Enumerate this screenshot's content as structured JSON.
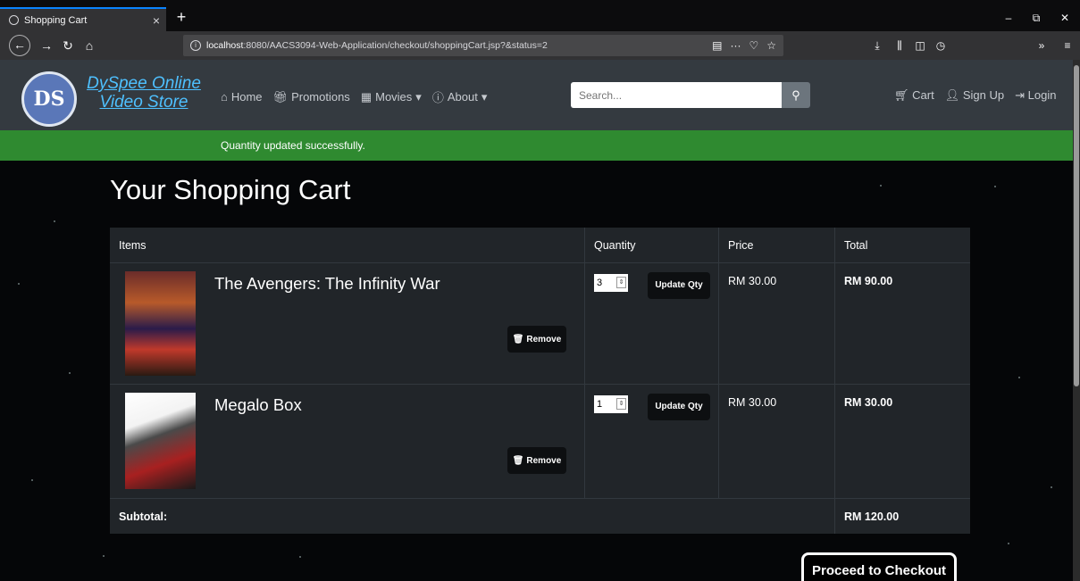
{
  "browser": {
    "tab_title": "Shopping Cart",
    "tab_close": "×",
    "new_tab": "+",
    "url_host": "localhost",
    "url_rest": ":8080/AACS3094-Web-Application/checkout/shoppingCart.jsp?&status=2",
    "window_controls": [
      "–",
      "⧉",
      "✕"
    ],
    "nav_icons": [
      "back-icon",
      "forward-icon",
      "reload-icon",
      "home-icon"
    ],
    "overflow": "»",
    "menu": "≡"
  },
  "site": {
    "logo_initials": "DS",
    "logo_line1": "DySpee Online",
    "logo_line2": "Video Store",
    "menu": {
      "home": "Home",
      "promotions": "Promotions",
      "movies": "Movies",
      "about": "About"
    },
    "search_placeholder": "Search...",
    "right_menu": {
      "cart": "Cart",
      "signup": "Sign Up",
      "login": "Login"
    }
  },
  "alert": {
    "message": "Quantity updated successfully."
  },
  "page_title": "Your Shopping Cart",
  "cart": {
    "headers": {
      "items": "Items",
      "quantity": "Quantity",
      "price": "Price",
      "total": "Total"
    },
    "rows": [
      {
        "title": "The Avengers: The Infinity War",
        "quantity": "3",
        "price": "RM 30.00",
        "total": "RM 90.00",
        "remove_label": "Remove",
        "update_label": "Update Qty"
      },
      {
        "title": "Megalo Box",
        "quantity": "1",
        "price": "RM 30.00",
        "total": "RM 30.00",
        "remove_label": "Remove",
        "update_label": "Update Qty"
      }
    ],
    "subtotal_label": "Subtotal:",
    "subtotal_value": "RM 120.00"
  },
  "checkout_label": "Proceed to Checkout",
  "colors": {
    "navbar": "#343a40",
    "alert": "#2f8a30",
    "table": "#212529",
    "accent": "#4ec0ff"
  }
}
